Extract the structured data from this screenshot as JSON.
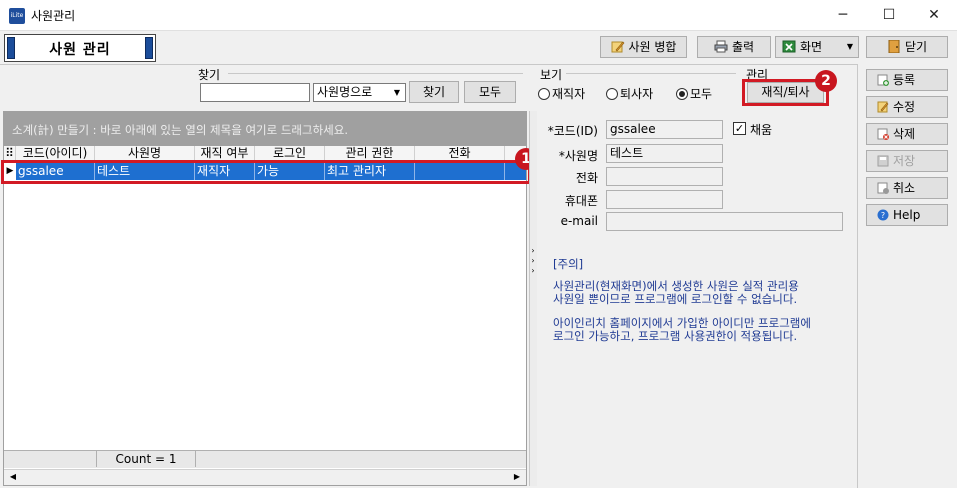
{
  "window": {
    "title": "사원관리",
    "app_icon_text": "iLite",
    "min": "─",
    "max": "☐",
    "close": "✕"
  },
  "header": {
    "panel_title": "사원 관리"
  },
  "toolbar": {
    "merge": "사원 병합",
    "print": "출력",
    "screen": "화면",
    "close": "닫기"
  },
  "search": {
    "group_label": "찾기",
    "input_value": "",
    "mode_value": "사원명으로",
    "find_button": "찾기",
    "all_button": "모두"
  },
  "view": {
    "group_label": "보기",
    "options": [
      "재직자",
      "퇴사자",
      "모두"
    ],
    "selected": "모두"
  },
  "manage": {
    "group_label": "관리",
    "button": "재직/퇴사"
  },
  "grid": {
    "group_hint": "소계(計) 만들기 : 바로 아래에 있는 열의 제목을 여기로 드래그하세요.",
    "columns": [
      "코드(아이디)",
      "사원명",
      "재직 여부",
      "로그인",
      "관리 권한",
      "전화"
    ],
    "rows": [
      [
        "gssalee",
        "테스트",
        "재직자",
        "가능",
        "최고 관리자",
        ""
      ]
    ],
    "footer_count": "Count = 1"
  },
  "form": {
    "code_label": "*코드(ID)",
    "code_value": "gssalee",
    "auto_label": "채움",
    "auto_checked": "✓",
    "name_label": "*사원명",
    "name_value": "테스트",
    "phone_label": "전화",
    "phone_value": "",
    "mobile_label": "휴대폰",
    "mobile_value": "",
    "email_label": "e-mail",
    "email_value": ""
  },
  "notice": {
    "title": "[주의]",
    "line1": "사원관리(현재화면)에서 생성한 사원은 실적 관리용",
    "line2": "사원일 뿐이므로 프로그램에 로그인할 수 없습니다.",
    "line3": "아이인리치 홈페이지에서 가입한 아이디만 프로그램에",
    "line4": "로그인 가능하고, 프로그램 사용권한이 적용됩니다."
  },
  "side_actions": {
    "register": "등록",
    "edit": "수정",
    "delete": "삭제",
    "save": "저장",
    "cancel": "취소",
    "help": "Help"
  },
  "markers": {
    "one": "1",
    "two": "2"
  },
  "colors": {
    "selection": "#1e6fd0",
    "highlight": "#d21a24",
    "notice_text": "#1f3a93",
    "title_bar_accent": "#1b4d9a"
  }
}
